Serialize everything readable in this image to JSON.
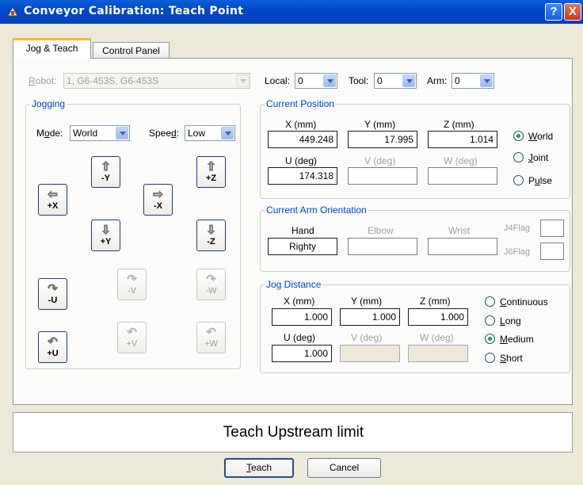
{
  "window": {
    "title": "Conveyor Calibration: Teach Point",
    "help_label": "?",
    "close_label": "X"
  },
  "tabs": [
    {
      "label": "Jog & Teach",
      "active": true
    },
    {
      "label": "Control Panel",
      "active": false
    }
  ],
  "robot": {
    "label": "Robot:",
    "value": "1, G6-453S, G6-453S",
    "enabled": false
  },
  "selectors": {
    "local": {
      "label": "Local:",
      "value": "0"
    },
    "tool": {
      "label": "Tool:",
      "value": "0"
    },
    "arm": {
      "label": "Arm:",
      "value": "0"
    }
  },
  "jogging": {
    "title": "Jogging",
    "mode": {
      "label": "Mode:",
      "value": "World"
    },
    "speed": {
      "label": "Speed:",
      "value": "Low"
    },
    "buttons": {
      "plus_x": "+X",
      "minus_y": "-Y",
      "plus_y": "+Y",
      "minus_x": "-X",
      "plus_z": "+Z",
      "minus_z": "-Z",
      "minus_u": "-U",
      "minus_v": "-V",
      "minus_w": "-W",
      "plus_u": "+U",
      "plus_v": "+V",
      "plus_w": "+W"
    }
  },
  "current_position": {
    "title": "Current Position",
    "x": {
      "label": "X (mm)",
      "value": "449.248"
    },
    "y": {
      "label": "Y (mm)",
      "value": "17.995"
    },
    "z": {
      "label": "Z (mm)",
      "value": "1.014"
    },
    "u": {
      "label": "U (deg)",
      "value": "174.318"
    },
    "v": {
      "label": "V (deg)",
      "value": ""
    },
    "w": {
      "label": "W (deg)",
      "value": ""
    },
    "modes": [
      {
        "label": "World",
        "selected": true
      },
      {
        "label": "Joint",
        "selected": false
      },
      {
        "label": "Pulse",
        "selected": false
      }
    ]
  },
  "orientation": {
    "title": "Current Arm Orientation",
    "hand": {
      "label": "Hand",
      "value": "Righty"
    },
    "elbow": {
      "label": "Elbow",
      "value": ""
    },
    "wrist": {
      "label": "Wrist",
      "value": ""
    },
    "j4flag": {
      "label": "J4Flag"
    },
    "j6flag": {
      "label": "J6Flag"
    }
  },
  "jog_distance": {
    "title": "Jog Distance",
    "x": {
      "label": "X (mm)",
      "value": "1.000"
    },
    "y": {
      "label": "Y (mm)",
      "value": "1.000"
    },
    "z": {
      "label": "Z (mm)",
      "value": "1.000"
    },
    "u": {
      "label": "U (deg)",
      "value": "1.000"
    },
    "v": {
      "label": "V (deg)",
      "value": ""
    },
    "w": {
      "label": "W (deg)",
      "value": ""
    },
    "options": [
      {
        "label": "Continuous",
        "selected": false
      },
      {
        "label": "Long",
        "selected": false
      },
      {
        "label": "Medium",
        "selected": true
      },
      {
        "label": "Short",
        "selected": false
      }
    ]
  },
  "status": {
    "text": "Teach Upstream limit"
  },
  "actions": {
    "teach": "Teach",
    "cancel": "Cancel"
  }
}
